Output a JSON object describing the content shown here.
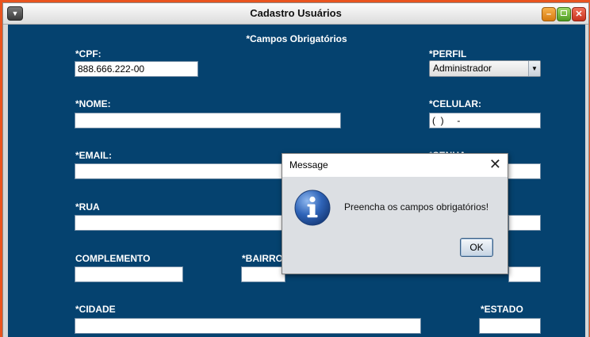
{
  "window": {
    "title": "Cadastro Usuários",
    "menu_glyph": "▼",
    "minimize_glyph": "–",
    "close_glyph": "✕"
  },
  "form": {
    "required_note": "*Campos Obrigatórios",
    "cpf": {
      "label": "*CPF:",
      "value": "888.666.222-00"
    },
    "perfil": {
      "label": "*PERFIL",
      "selected": "Administrador"
    },
    "nome": {
      "label": "*NOME:",
      "value": ""
    },
    "celular": {
      "label": "*CELULAR:",
      "value": "(  )     -"
    },
    "email": {
      "label": "*EMAIL:",
      "value": ""
    },
    "senha": {
      "label": "*SENHA:",
      "value": ""
    },
    "rua": {
      "label": "*RUA",
      "value": ""
    },
    "numero": {
      "value": ""
    },
    "complemento": {
      "label": "COMPLEMENTO",
      "value": ""
    },
    "bairro": {
      "label": "*BAIRRO",
      "value": ""
    },
    "cep": {
      "value": ""
    },
    "cidade": {
      "label": "*CIDADE",
      "value": ""
    },
    "estado": {
      "label": "*ESTADO",
      "value": ""
    }
  },
  "dialog": {
    "title": "Message",
    "close_glyph": "✕",
    "icon": "info-icon",
    "message": "Preencha os campos obrigatórios!",
    "ok_label": "OK"
  },
  "colors": {
    "form_background": "#05426f",
    "desktop_background": "#e9541f"
  }
}
